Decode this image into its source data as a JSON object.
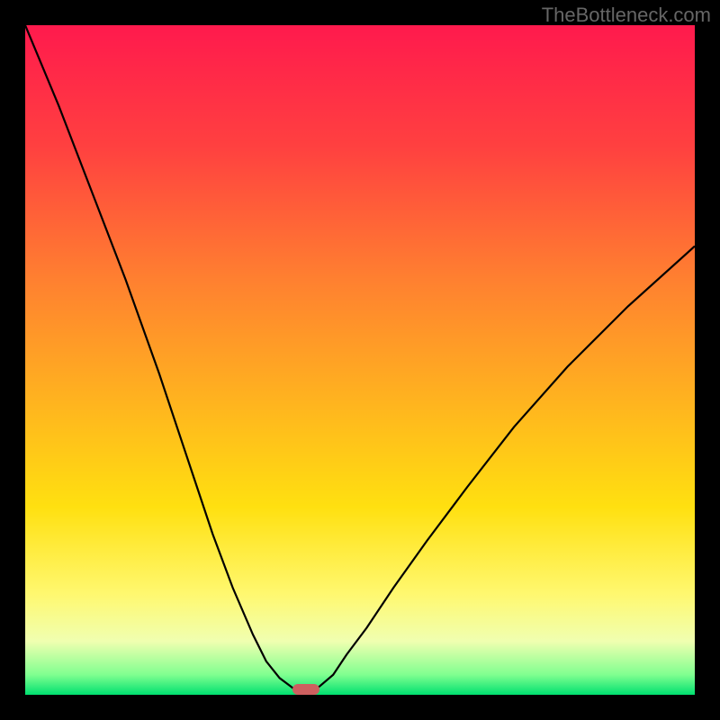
{
  "watermark": "TheBottleneck.com",
  "chart_data": {
    "type": "line",
    "title": "",
    "xlabel": "",
    "ylabel": "",
    "xlim": [
      0,
      100
    ],
    "ylim": [
      0,
      100
    ],
    "gradient": {
      "description": "Vertical gradient from red (top, high bottleneck) through orange, yellow to green (bottom, no bottleneck)",
      "stops": [
        {
          "pos": 0.0,
          "color": "#ff1a4d"
        },
        {
          "pos": 0.18,
          "color": "#ff4040"
        },
        {
          "pos": 0.38,
          "color": "#ff8030"
        },
        {
          "pos": 0.55,
          "color": "#ffb020"
        },
        {
          "pos": 0.72,
          "color": "#ffe010"
        },
        {
          "pos": 0.85,
          "color": "#fff870"
        },
        {
          "pos": 0.92,
          "color": "#f0ffb0"
        },
        {
          "pos": 0.97,
          "color": "#80ff90"
        },
        {
          "pos": 1.0,
          "color": "#00e070"
        }
      ]
    },
    "series": [
      {
        "name": "left-curve",
        "x": [
          0,
          5,
          10,
          15,
          20,
          25,
          28,
          31,
          34,
          36,
          38,
          40,
          41,
          42
        ],
        "y": [
          100,
          88,
          75,
          62,
          48,
          33,
          24,
          16,
          9,
          5,
          2.5,
          1,
          0.4,
          0
        ]
      },
      {
        "name": "right-curve",
        "x": [
          42,
          43,
          44,
          46,
          48,
          51,
          55,
          60,
          66,
          73,
          81,
          90,
          100
        ],
        "y": [
          0,
          0.5,
          1.3,
          3,
          6,
          10,
          16,
          23,
          31,
          40,
          49,
          58,
          67
        ]
      }
    ],
    "marker": {
      "x": 42,
      "y": 0,
      "color": "#cd5f5f"
    }
  }
}
